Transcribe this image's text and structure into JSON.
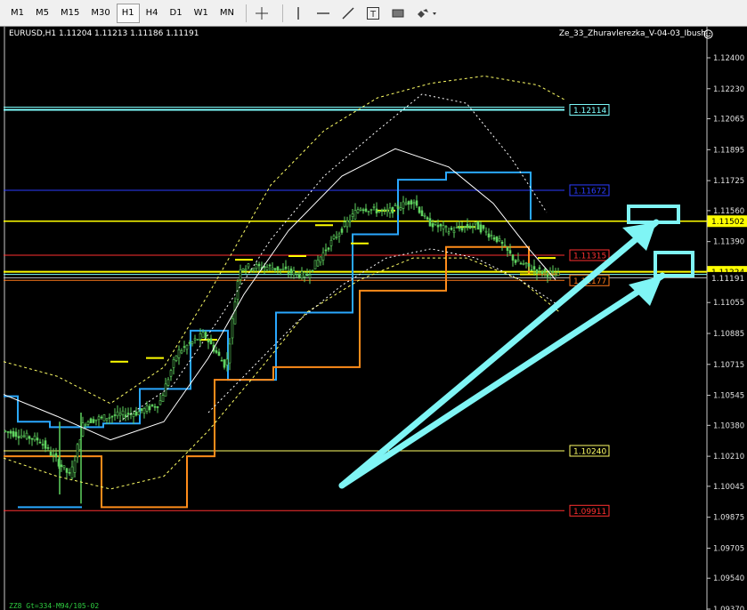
{
  "toolbar": {
    "timeframes": [
      "M1",
      "M5",
      "M15",
      "M30",
      "H1",
      "H4",
      "D1",
      "W1",
      "MN"
    ],
    "active_timeframe": "H1",
    "tools": [
      "crosshair-icon",
      "vertical-line-icon",
      "horizontal-line-icon",
      "trendline-icon",
      "text-icon",
      "rectangle-icon",
      "shapes-dropdown-icon"
    ]
  },
  "chart": {
    "symbol_line": "EURUSD,H1  1.11204 1.11213 1.11186 1.11191",
    "indicator_name": "Ze_33_Zhuravlerezka_V-04-03_Ibush",
    "footer_label": "ZZ8 Gt=334-M94/105-02",
    "price_ticks": [
      "1.12400",
      "1.12230",
      "1.12065",
      "1.11895",
      "1.11725",
      "1.11560",
      "1.11390",
      "1.11055",
      "1.10885",
      "1.10715",
      "1.10545",
      "1.10380",
      "1.10210",
      "1.10045",
      "1.09875",
      "1.09705",
      "1.09540",
      "1.09370"
    ],
    "price_levels": [
      {
        "label": "1.12114",
        "color": "#7fffff"
      },
      {
        "label": "1.11672",
        "color": "#2b3cff"
      },
      {
        "label": "1.11502",
        "color": "#ffff00"
      },
      {
        "label": "1.11315",
        "color": "#ff3030"
      },
      {
        "label": "1.11224",
        "color": "#ffff00"
      },
      {
        "label": "1.11191",
        "color": "#bbbbbb"
      },
      {
        "label": "1.11177",
        "color": "#ff7a1a"
      },
      {
        "label": "1.10240",
        "color": "#ffff66"
      },
      {
        "label": "1.09911",
        "color": "#ff3030"
      }
    ],
    "colors": {
      "candles": "#5fd35f",
      "arrows": "#7ff5f5",
      "blue_channel": "#2aa8ff",
      "orange_channel": "#ff8c1a",
      "marks": "#ffff00"
    }
  }
}
